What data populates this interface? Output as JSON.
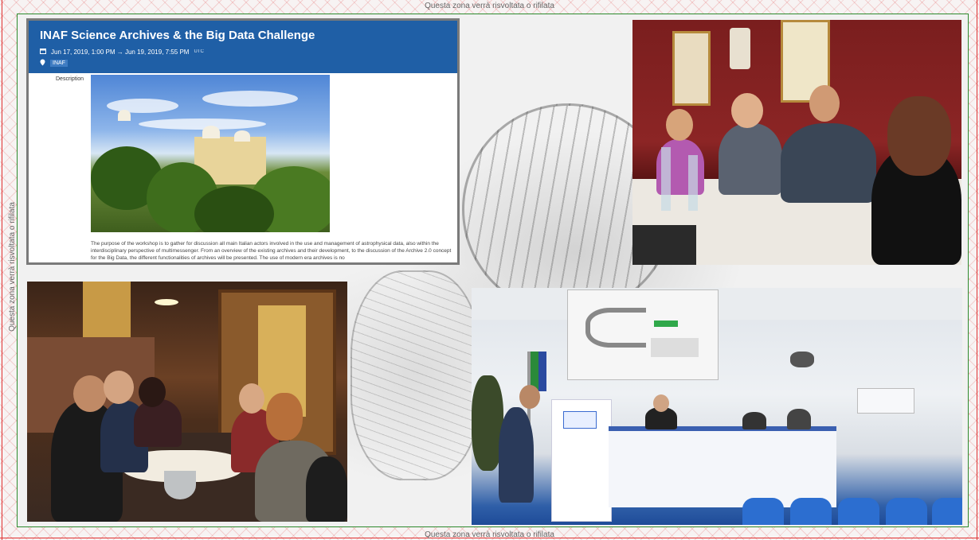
{
  "trim_notice": "Questa zona verrà risvoltata o rifilata",
  "event": {
    "title": "INAF Science Archives & the Big Data Challenge",
    "dates": "Jun 17, 2019, 1:00 PM → Jun 19, 2019, 7:55 PM",
    "timezone": "UTC",
    "location": "INAF",
    "description_label": "Description",
    "description_text": "The purpose of the workshop is to gather for discussion all main Italian actors involved in the use and management of astrophysical data, also within the interdisciplinary perspective of multimessenger. From an overview of the existing archives and their development, to the discussion of the Archive 2.0 concept for the Big Data, the different functionalities of archives will be presented. The use of modern era archives is no"
  },
  "colors": {
    "header_blue": "#1f5fa6",
    "bleed_red": "#e03030",
    "safe_green": "#2d8a2d"
  }
}
